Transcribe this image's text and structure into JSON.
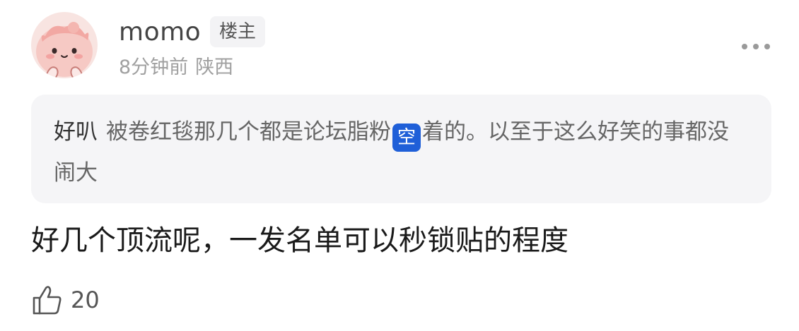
{
  "post": {
    "author": {
      "name": "momo",
      "badge": "楼主",
      "time": "8分钟前",
      "location": "陕西"
    },
    "quote": {
      "author": "好叭",
      "text_before": "被卷红毯那几个都是论坛脂粉",
      "censor_badge": "空",
      "text_after": "着的。以至于这么好笑的事都没闹大"
    },
    "content": "好几个顶流呢，一发名单可以秒锁贴的程度",
    "likes": "20",
    "icons": {
      "more": "more-dots-icon",
      "like": "thumbs-up-icon",
      "avatar": "pink-cartoon-avatar"
    },
    "colors": {
      "censor_badge_bg": "#1f5fd8",
      "quote_bg": "#f5f5f7",
      "avatar_bg": "#f7d3cf"
    }
  }
}
